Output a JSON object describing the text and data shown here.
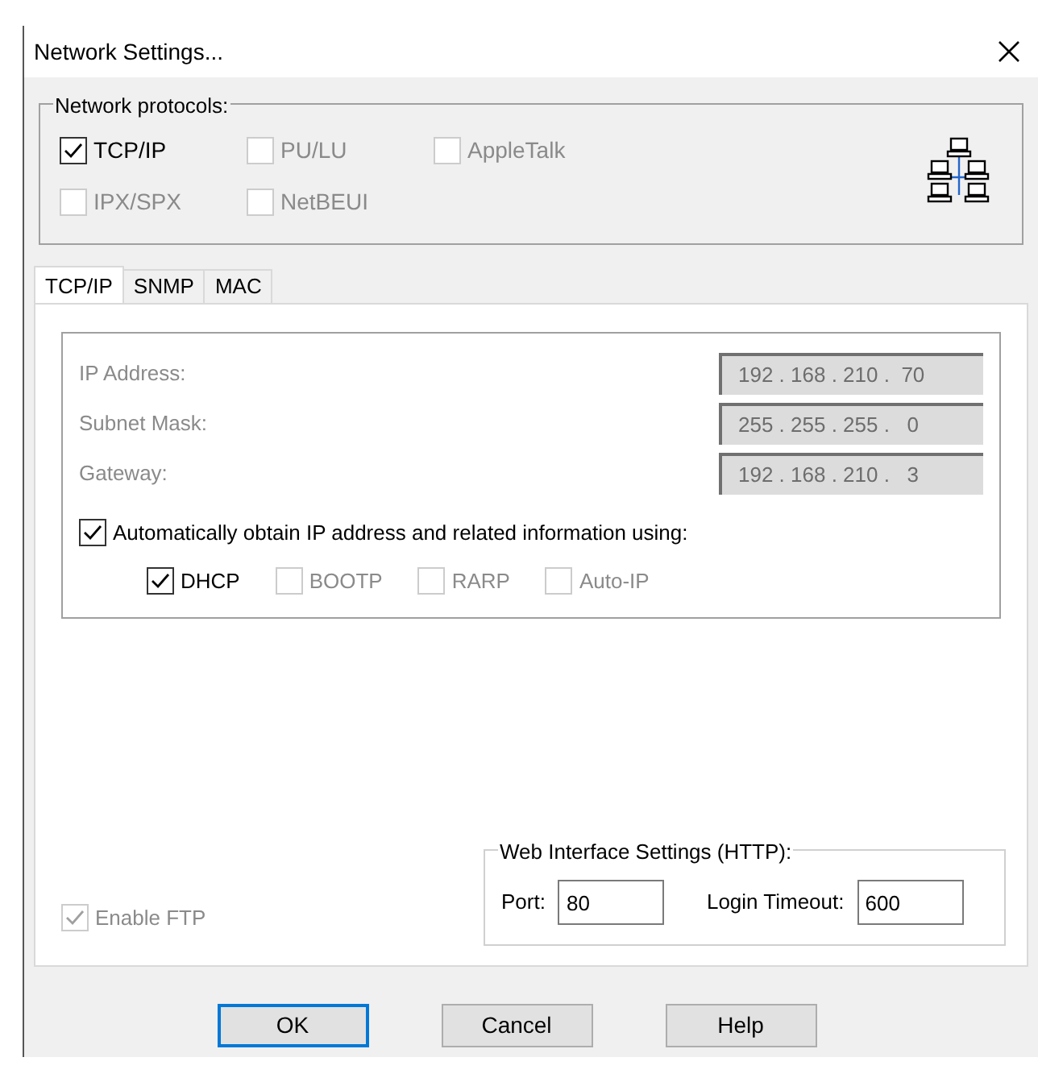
{
  "window": {
    "title": "Network Settings..."
  },
  "protocols": {
    "label": "Network protocols:",
    "items": [
      {
        "label": "TCP/IP",
        "checked": true,
        "disabled": false
      },
      {
        "label": "PU/LU",
        "checked": false,
        "disabled": true
      },
      {
        "label": "AppleTalk",
        "checked": false,
        "disabled": true
      },
      {
        "label": "IPX/SPX",
        "checked": false,
        "disabled": true
      },
      {
        "label": "NetBEUI",
        "checked": false,
        "disabled": true
      }
    ]
  },
  "tabs": [
    {
      "label": "TCP/IP",
      "selected": true
    },
    {
      "label": "SNMP",
      "selected": false
    },
    {
      "label": "MAC",
      "selected": false
    }
  ],
  "tcpip": {
    "fields": [
      {
        "label": "IP Address:",
        "value": "192 . 168 . 210 .  70",
        "disabled": true
      },
      {
        "label": "Subnet Mask:",
        "value": "255 . 255 . 255 .   0",
        "disabled": true
      },
      {
        "label": "Gateway:",
        "value": "192 . 168 . 210 .   3",
        "disabled": true
      }
    ],
    "auto": {
      "label": "Automatically obtain IP address and related information using:",
      "checked": true
    },
    "methods": [
      {
        "label": "DHCP",
        "checked": true,
        "disabled": false
      },
      {
        "label": "BOOTP",
        "checked": false,
        "disabled": true
      },
      {
        "label": "RARP",
        "checked": false,
        "disabled": true
      },
      {
        "label": "Auto-IP",
        "checked": false,
        "disabled": true
      }
    ]
  },
  "web_interface": {
    "title": "Web Interface Settings (HTTP):",
    "port_label": "Port:",
    "port": "80",
    "timeout_label": "Login Timeout:",
    "timeout": "600"
  },
  "enable_ftp": {
    "label": "Enable FTP",
    "checked": true,
    "disabled": true
  },
  "buttons": [
    {
      "label": "OK",
      "focused": true
    },
    {
      "label": "Cancel",
      "focused": false
    },
    {
      "label": "Help",
      "focused": false
    }
  ]
}
